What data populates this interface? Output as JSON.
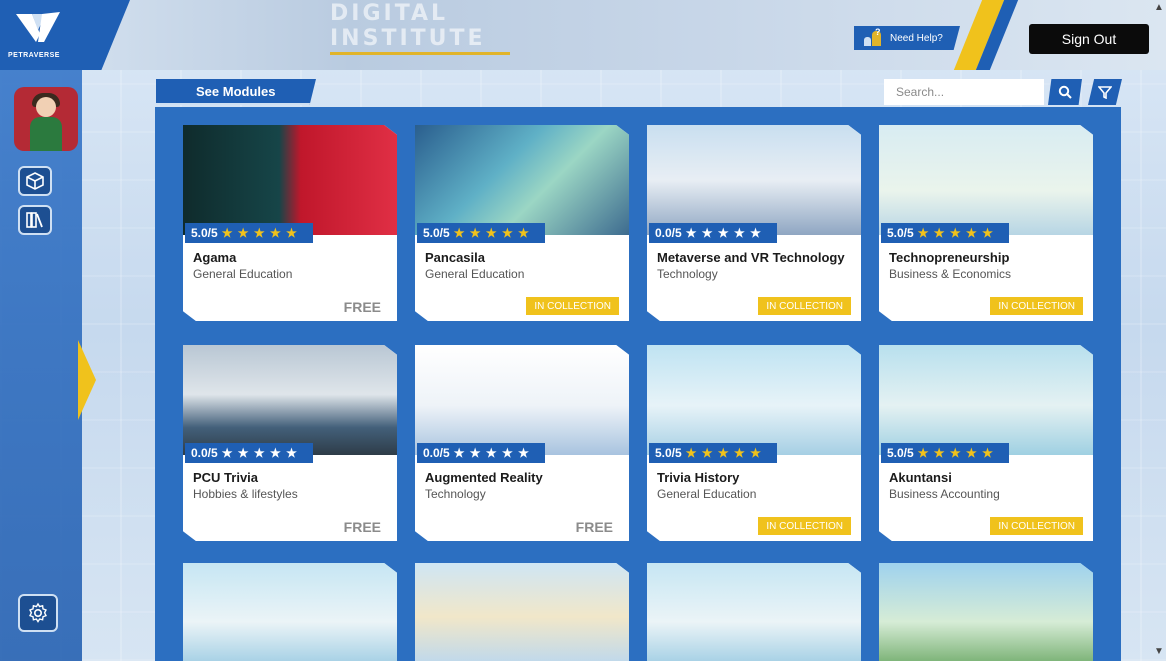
{
  "header": {
    "logo_text": "PETRAVERSE",
    "banner_text": "DIGITAL INSTITUTE",
    "help_label": "Need Help?",
    "signout_label": "Sign Out"
  },
  "toolbar": {
    "see_modules_label": "See Modules",
    "search_placeholder": "Search..."
  },
  "colors": {
    "accent_blue": "#1f5fb4",
    "panel_blue": "#2c6fc1",
    "accent_yellow": "#f0c21c"
  },
  "modules": [
    {
      "title": "Agama",
      "category": "General Education",
      "rating": "5.0/5",
      "stars": "★ ★ ★ ★ ★",
      "status": "FREE"
    },
    {
      "title": "Pancasila",
      "category": "General Education",
      "rating": "5.0/5",
      "stars": "★ ★ ★ ★ ★",
      "status": "IN COLLECTION"
    },
    {
      "title": "Metaverse and VR Technology",
      "category": "Technology",
      "rating": "0.0/5",
      "stars": "★ ★ ★ ★ ★",
      "status": "IN COLLECTION"
    },
    {
      "title": "Technopreneurship",
      "category": "Business & Economics",
      "rating": "5.0/5",
      "stars": "★ ★ ★ ★ ★",
      "status": "IN COLLECTION"
    },
    {
      "title": "PCU Trivia",
      "category": "Hobbies & lifestyles",
      "rating": "0.0/5",
      "stars": "★ ★ ★ ★ ★",
      "status": "FREE"
    },
    {
      "title": "Augmented Reality",
      "category": "Technology",
      "rating": "0.0/5",
      "stars": "★ ★ ★ ★ ★",
      "status": "FREE"
    },
    {
      "title": "Trivia History",
      "category": "General Education",
      "rating": "5.0/5",
      "stars": "★ ★ ★ ★ ★",
      "status": "IN COLLECTION"
    },
    {
      "title": "Akuntansi",
      "category": "Business Accounting",
      "rating": "5.0/5",
      "stars": "★ ★ ★ ★ ★",
      "status": "IN COLLECTION"
    }
  ]
}
